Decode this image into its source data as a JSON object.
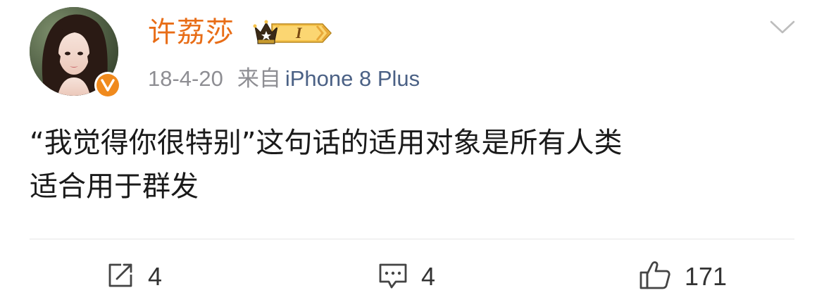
{
  "post": {
    "username": "许荔莎",
    "member_badge_level": "I",
    "timestamp": "18-4-20",
    "source_label": "来自",
    "source_device": "iPhone 8 Plus",
    "content_lines": [
      "“我觉得你很特别”这句话的适用对象是所有人类",
      "适合用于群发"
    ]
  },
  "actions": {
    "repost_count": "4",
    "comment_count": "4",
    "like_count": "171"
  },
  "icons": {
    "avatar": "avatar-photo",
    "verified": "verified-v-icon",
    "member": "crown-member-icon",
    "more": "chevron-down-icon",
    "repost": "repost-icon",
    "comment": "comment-icon",
    "like": "thumbs-up-icon"
  },
  "colors": {
    "username": "#e86d17",
    "verified_badge": "#f08a1d",
    "meta_text": "#8e8e93",
    "device_text": "#4b6185",
    "body_text": "#1a1a1a",
    "action_icon": "#444444"
  }
}
